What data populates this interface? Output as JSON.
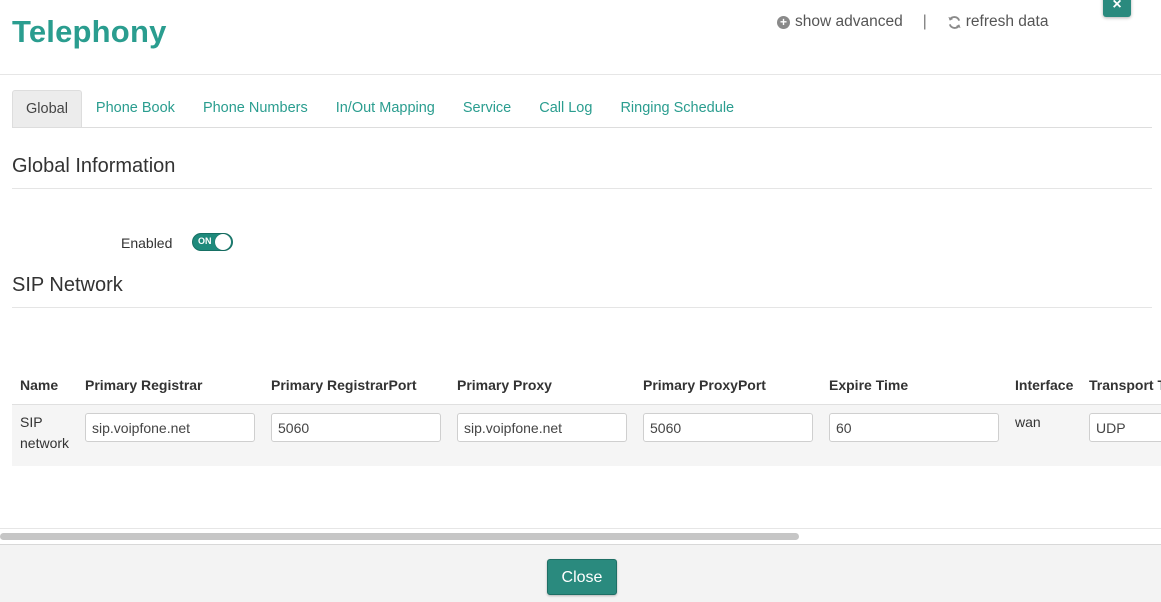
{
  "app": {
    "title": "Telephony"
  },
  "header": {
    "show_advanced_label": "show advanced",
    "separator": "|",
    "refresh_label": "refresh data"
  },
  "tabs": [
    {
      "label": "Global",
      "active": true
    },
    {
      "label": "Phone Book"
    },
    {
      "label": "Phone Numbers"
    },
    {
      "label": "In/Out Mapping"
    },
    {
      "label": "Service"
    },
    {
      "label": "Call Log"
    },
    {
      "label": "Ringing Schedule"
    }
  ],
  "global": {
    "section_title": "Global Information",
    "enabled_label": "Enabled",
    "enabled_toggle_text": "ON",
    "enabled": true
  },
  "sip": {
    "section_title": "SIP Network",
    "columns": [
      "Name",
      "Primary Registrar",
      "Primary RegistrarPort",
      "Primary Proxy",
      "Primary ProxyPort",
      "Expire Time",
      "Interface",
      "Transport T"
    ],
    "row": {
      "name_line1": "SIP",
      "name_line2": "network",
      "primary_registrar": "sip.voipfone.net",
      "primary_registrar_port": "5060",
      "primary_proxy": "sip.voipfone.net",
      "primary_proxy_port": "5060",
      "expire_time": "60",
      "interface": "wan",
      "transport": "UDP"
    }
  },
  "footer": {
    "close_label": "Close"
  },
  "colors": {
    "accent": "#2a9d8f",
    "button": "#2a8a7e"
  },
  "icons": [
    "plus-circle-icon",
    "refresh-icon",
    "close-icon"
  ]
}
